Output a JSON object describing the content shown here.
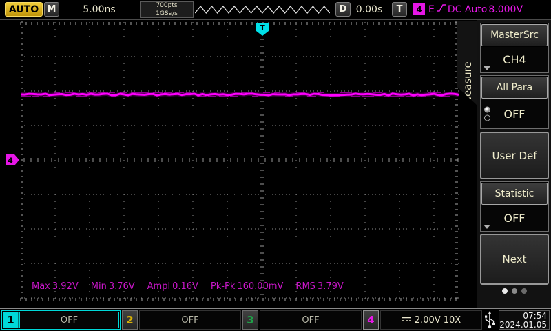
{
  "top_bar": {
    "auto": "AUTO",
    "m": "M",
    "timebase": "5.00ns",
    "points": "700pts",
    "sample_rate": "1GSa/s",
    "d": "D",
    "delay": "0.00s",
    "t": "T",
    "trigger_source": "4",
    "trigger_type": "E",
    "trigger_coupling_mode": "DC Auto",
    "trigger_level": "8.000V"
  },
  "plot": {
    "trigger_marker_label": "T",
    "channel_marker_label": "4",
    "measurements": [
      {
        "label": "Max",
        "value": "3.92V"
      },
      {
        "label": "Min",
        "value": "3.76V"
      },
      {
        "label": "Ampl",
        "value": "0.16V"
      },
      {
        "label": "Pk-Pk",
        "value": "160.00mV"
      },
      {
        "label": "RMS",
        "value": "3.79V"
      }
    ]
  },
  "trace": {
    "channel": "4",
    "color": "#ff00ff",
    "level_v": 3.8,
    "volts_per_div": 2,
    "description": "flat noisy DC level around 3.79 V on CH4"
  },
  "menu": {
    "tab": "Measure",
    "master_src_label": "MasterSrc",
    "master_src_value": "CH4",
    "all_para_label": "All Para",
    "all_para_value": "OFF",
    "user_def_label": "User Def",
    "statistic_label": "Statistic",
    "statistic_value": "OFF",
    "next_label": "Next"
  },
  "channels": [
    {
      "id": "1",
      "value": "OFF"
    },
    {
      "id": "2",
      "value": "OFF"
    },
    {
      "id": "3",
      "value": "OFF"
    },
    {
      "id": "4",
      "volts": "2.00V",
      "probe": "10X"
    }
  ],
  "status": {
    "time": "07:54",
    "date": "2024.01.05"
  },
  "colors": {
    "trace": "#ff00ff",
    "ch1": "#00d8d8",
    "ch2": "#d8b207",
    "ch3": "#1fa048",
    "ch4": "#e616e6",
    "trigger_marker": "#00e0e8",
    "accent_yellow": "#e8ba10",
    "menu_text": "#efeccb",
    "measure_text": "#c816c8"
  }
}
